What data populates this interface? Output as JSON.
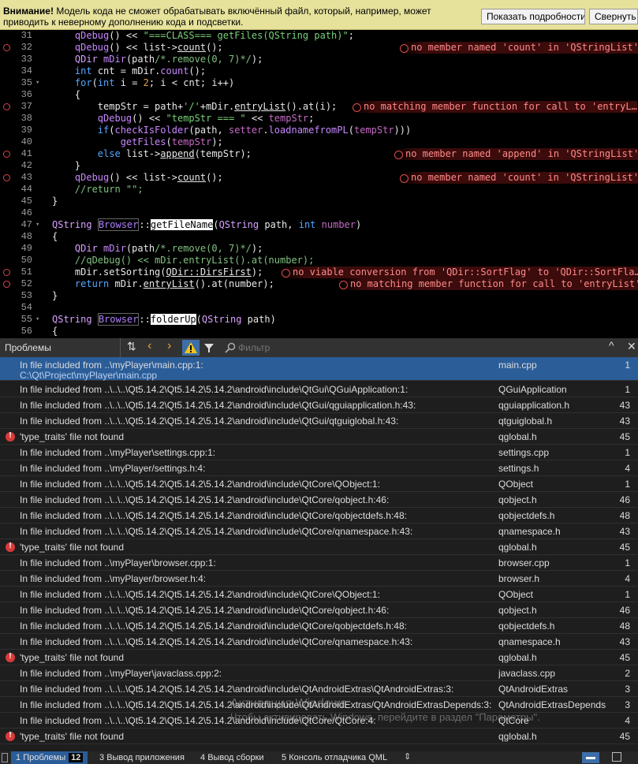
{
  "warning": {
    "strong": "Внимание!",
    "text": " Модель кода не сможет обрабатывать включённый файл, который, например, может приводить к неверному дополнению кода и подсветки.",
    "details_button": "Показать подробности",
    "collapse_button": "Свернуть"
  },
  "problems_panel": {
    "title": "Проблемы",
    "filter_placeholder": "Фильтр",
    "rows": [
      {
        "type": "info",
        "message": "In file included from ..\\myPlayer\\main.cpp:1:",
        "sub": "C:\\Qt\\Project\\myPlayer\\main.cpp",
        "file": "main.cpp",
        "line": "1"
      },
      {
        "type": "info",
        "message": "In file included from ..\\..\\..\\Qt5.14.2\\Qt5.14.2\\5.14.2\\android\\include\\QtGui\\QGuiApplication:1:",
        "file": "QGuiApplication",
        "line": "1"
      },
      {
        "type": "info",
        "message": "In file included from ..\\..\\..\\Qt5.14.2\\Qt5.14.2\\5.14.2\\android\\include\\QtGui/qguiapplication.h:43:",
        "file": "qguiapplication.h",
        "line": "43"
      },
      {
        "type": "info",
        "message": "In file included from ..\\..\\..\\Qt5.14.2\\Qt5.14.2\\5.14.2\\android\\include\\QtGui/qtguiglobal.h:43:",
        "file": "qtguiglobal.h",
        "line": "43"
      },
      {
        "type": "error",
        "message": "'type_traits' file not found",
        "file": "qglobal.h",
        "line": "45"
      },
      {
        "type": "info",
        "message": "In file included from ..\\myPlayer\\settings.cpp:1:",
        "file": "settings.cpp",
        "line": "1"
      },
      {
        "type": "info",
        "message": "In file included from ..\\myPlayer/settings.h:4:",
        "file": "settings.h",
        "line": "4"
      },
      {
        "type": "info",
        "message": "In file included from ..\\..\\..\\Qt5.14.2\\Qt5.14.2\\5.14.2\\android\\include\\QtCore\\QObject:1:",
        "file": "QObject",
        "line": "1"
      },
      {
        "type": "info",
        "message": "In file included from ..\\..\\..\\Qt5.14.2\\Qt5.14.2\\5.14.2\\android\\include\\QtCore/qobject.h:46:",
        "file": "qobject.h",
        "line": "46"
      },
      {
        "type": "info",
        "message": "In file included from ..\\..\\..\\Qt5.14.2\\Qt5.14.2\\5.14.2\\android\\include\\QtCore/qobjectdefs.h:48:",
        "file": "qobjectdefs.h",
        "line": "48"
      },
      {
        "type": "info",
        "message": "In file included from ..\\..\\..\\Qt5.14.2\\Qt5.14.2\\5.14.2\\android\\include\\QtCore/qnamespace.h:43:",
        "file": "qnamespace.h",
        "line": "43"
      },
      {
        "type": "error",
        "message": "'type_traits' file not found",
        "file": "qglobal.h",
        "line": "45"
      },
      {
        "type": "info",
        "message": "In file included from ..\\myPlayer\\browser.cpp:1:",
        "file": "browser.cpp",
        "line": "1"
      },
      {
        "type": "info",
        "message": "In file included from ..\\myPlayer/browser.h:4:",
        "file": "browser.h",
        "line": "4"
      },
      {
        "type": "info",
        "message": "In file included from ..\\..\\..\\Qt5.14.2\\Qt5.14.2\\5.14.2\\android\\include\\QtCore\\QObject:1:",
        "file": "QObject",
        "line": "1"
      },
      {
        "type": "info",
        "message": "In file included from ..\\..\\..\\Qt5.14.2\\Qt5.14.2\\5.14.2\\android\\include\\QtCore/qobject.h:46:",
        "file": "qobject.h",
        "line": "46"
      },
      {
        "type": "info",
        "message": "In file included from ..\\..\\..\\Qt5.14.2\\Qt5.14.2\\5.14.2\\android\\include\\QtCore/qobjectdefs.h:48:",
        "file": "qobjectdefs.h",
        "line": "48"
      },
      {
        "type": "info",
        "message": "In file included from ..\\..\\..\\Qt5.14.2\\Qt5.14.2\\5.14.2\\android\\include\\QtCore/qnamespace.h:43:",
        "file": "qnamespace.h",
        "line": "43"
      },
      {
        "type": "error",
        "message": "'type_traits' file not found",
        "file": "qglobal.h",
        "line": "45"
      },
      {
        "type": "info",
        "message": "In file included from ..\\myPlayer\\javaclass.cpp:2:",
        "file": "javaclass.cpp",
        "line": "2"
      },
      {
        "type": "info",
        "message": "In file included from ..\\..\\..\\Qt5.14.2\\Qt5.14.2\\5.14.2\\android\\include\\QtAndroidExtras\\QtAndroidExtras:3:",
        "file": "QtAndroidExtras",
        "line": "3"
      },
      {
        "type": "info",
        "message": "In file included from ..\\..\\..\\Qt5.14.2\\Qt5.14.2\\5.14.2\\android\\include\\QtAndroidExtras/QtAndroidExtrasDepends:3:",
        "file": "QtAndroidExtrasDepends",
        "line": "3"
      },
      {
        "type": "info",
        "message": "In file included from ..\\..\\..\\Qt5.14.2\\Qt5.14.2\\5.14.2\\android\\include\\QtCore/QtCore:4:",
        "file": "QtCore",
        "line": "4"
      },
      {
        "type": "error",
        "message": "'type_traits' file not found",
        "file": "qglobal.h",
        "line": "45"
      }
    ]
  },
  "editor": {
    "diagnostics": {
      "d32": "no member named 'count' in 'QStringList'",
      "d37": "no matching member function for call to 'entryL…",
      "d41": "no member named 'append' in 'QStringList'",
      "d43": "no member named 'count' in 'QStringList'",
      "d51": "no viable conversion from 'QDir::SortFlag' to 'QDir::SortFla…",
      "d52": "no matching member function for call to 'entryList'"
    }
  },
  "watermark": {
    "line1": "Активация Windows",
    "line2": "Чтобы активировать Windows, перейдите в раздел \"Параметры\"."
  },
  "status_tabs": [
    {
      "num": "1",
      "label": "Проблемы",
      "badge": "12"
    },
    {
      "num": "3",
      "label": "Вывод приложения"
    },
    {
      "num": "4",
      "label": "Вывод сборки"
    },
    {
      "num": "5",
      "label": "Консоль отладчика QML"
    }
  ]
}
